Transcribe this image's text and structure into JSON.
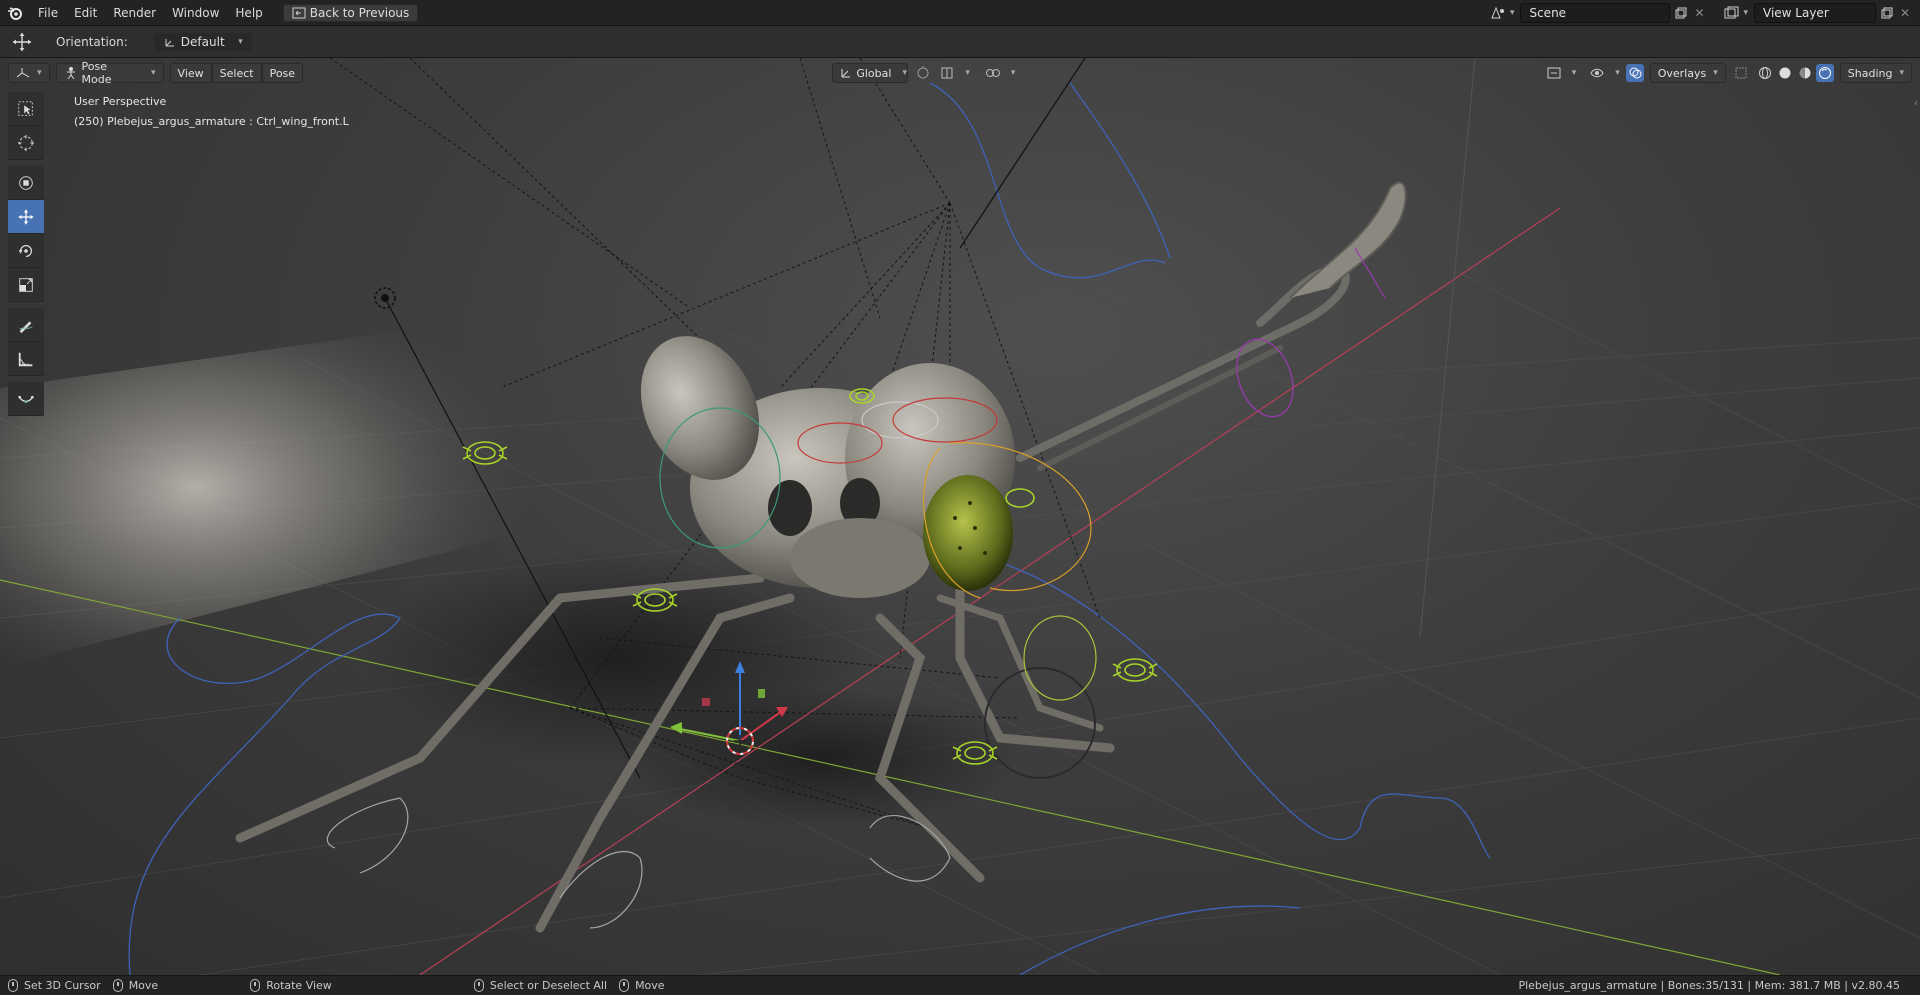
{
  "topbar": {
    "menus": [
      "File",
      "Edit",
      "Render",
      "Window",
      "Help"
    ],
    "back_button": "Back to Previous",
    "scene_label": "Scene",
    "view_layer_label": "View Layer"
  },
  "tool_header": {
    "orientation_label": "Orientation:",
    "orientation_value": "Default"
  },
  "viewport_header": {
    "mode": "Pose Mode",
    "menus": [
      "View",
      "Select",
      "Pose"
    ],
    "transform_orientation": "Global",
    "overlays_label": "Overlays",
    "shading_label": "Shading"
  },
  "viewport": {
    "perspective_label": "User Perspective",
    "object_info": "(250) Plebejus_argus_armature : Ctrl_wing_front.L"
  },
  "toolbar": {
    "tools": [
      "select-box",
      "cursor",
      "move-all",
      "move",
      "rotate",
      "scale",
      "annotate",
      "measure",
      "pose-relax"
    ],
    "active_tool": "move"
  },
  "statusbar": {
    "items": [
      "Set 3D Cursor",
      "Move",
      "Rotate View",
      "Select or Deselect All",
      "Move"
    ],
    "info": "Plebejus_argus_armature | Bones:35/131 | Mem: 381.7 MB | v2.80.45"
  },
  "colors": {
    "accent": "#4772b3",
    "x_axis": "#c4455a",
    "y_axis": "#8db33a",
    "controller_green": "#a8d42a",
    "curve_blue": "#3e63b8"
  }
}
